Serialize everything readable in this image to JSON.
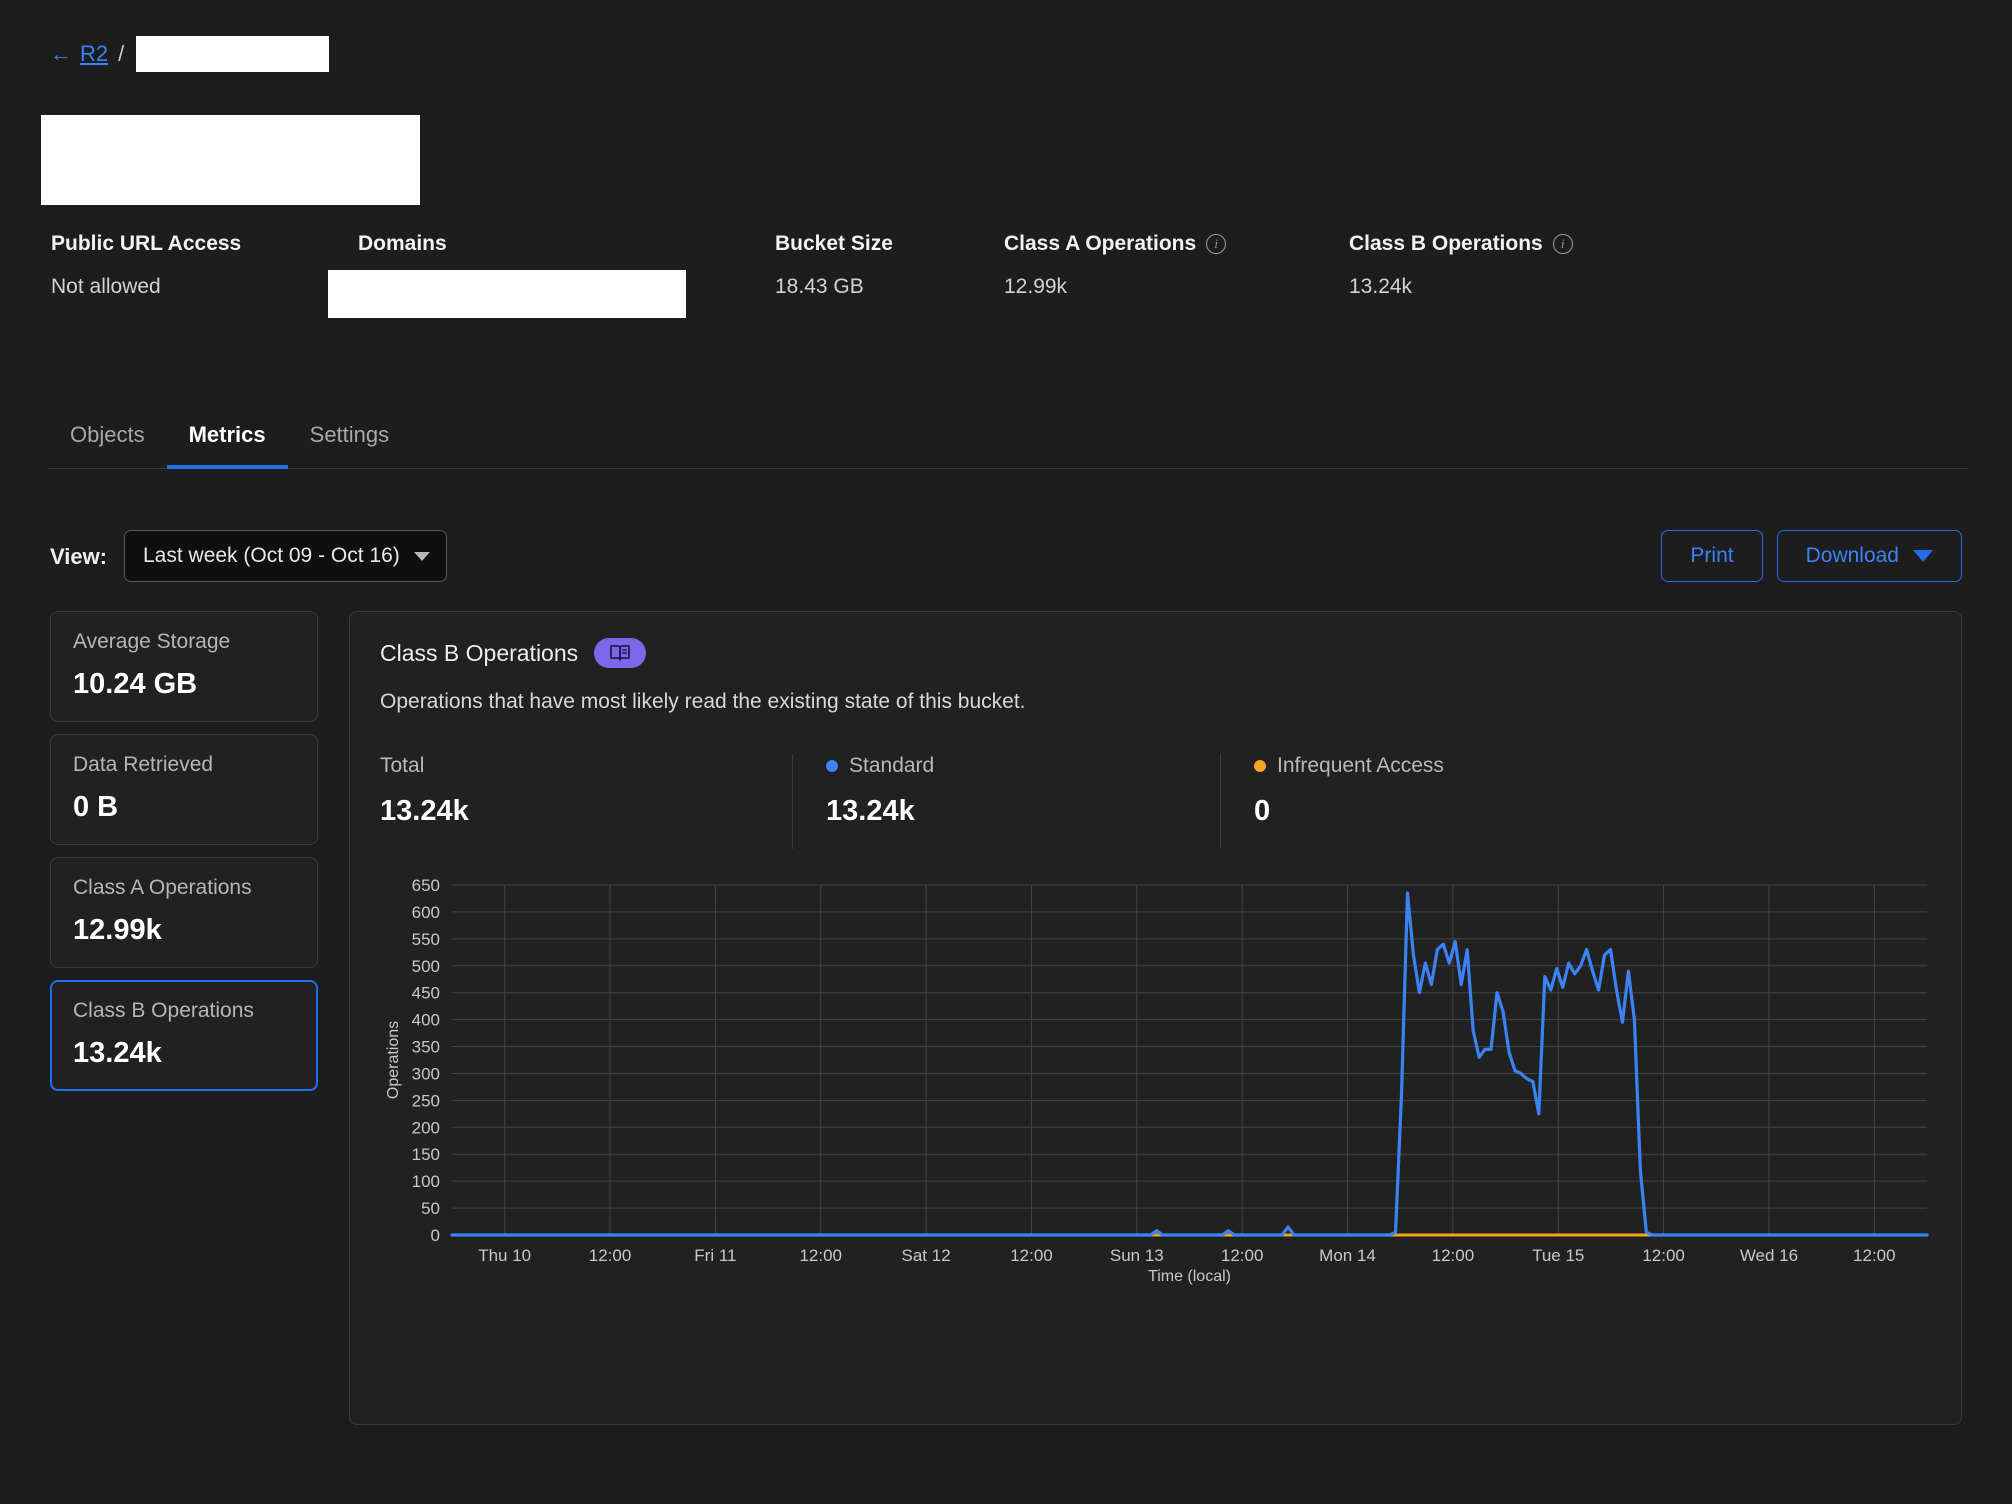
{
  "breadcrumb": {
    "back_icon": "arrow-left-icon",
    "root_label": "R2",
    "separator": "/",
    "bucket_name_redacted": true
  },
  "header_stats": [
    {
      "label": "Public URL Access",
      "value": "Not allowed",
      "info": false
    },
    {
      "label": "Domains",
      "value": "",
      "info": false,
      "redacted": true
    },
    {
      "label": "Bucket Size",
      "value": "18.43 GB",
      "info": false
    },
    {
      "label": "Class A Operations",
      "value": "12.99k",
      "info": true
    },
    {
      "label": "Class B Operations",
      "value": "13.24k",
      "info": true
    }
  ],
  "tabs": [
    {
      "label": "Objects",
      "active": false
    },
    {
      "label": "Metrics",
      "active": true
    },
    {
      "label": "Settings",
      "active": false
    }
  ],
  "toolbar": {
    "view_label": "View:",
    "view_value": "Last week (Oct 09 - Oct 16)",
    "print_label": "Print",
    "download_label": "Download"
  },
  "metric_cards": [
    {
      "label": "Average Storage",
      "value": "10.24 GB",
      "selected": false
    },
    {
      "label": "Data Retrieved",
      "value": "0 B",
      "selected": false
    },
    {
      "label": "Class A Operations",
      "value": "12.99k",
      "selected": false
    },
    {
      "label": "Class B Operations",
      "value": "13.24k",
      "selected": true
    }
  ],
  "panel": {
    "title": "Class B Operations",
    "badge_icon": "book-icon",
    "description": "Operations that have most likely read the existing state of this bucket.",
    "totals": [
      {
        "label": "Total",
        "value": "13.24k",
        "dot_color": null
      },
      {
        "label": "Standard",
        "value": "13.24k",
        "dot_color": "#3b82f6"
      },
      {
        "label": "Infrequent Access",
        "value": "0",
        "dot_color": "#f5a524"
      }
    ]
  },
  "colors": {
    "accent_blue": "#1f6feb",
    "link_blue": "#3b82f6",
    "standard_series": "#3b82f6",
    "infrequent_series": "#f5a524",
    "badge_purple": "#7b68e8",
    "page_bg": "#1d1d1d",
    "panel_bg": "#212121",
    "border": "#3a3a3a"
  },
  "chart_data": {
    "type": "line",
    "title": "",
    "xlabel": "Time (local)",
    "ylabel": "Operations",
    "ylim": [
      0,
      650
    ],
    "yticks": [
      0,
      50,
      100,
      150,
      200,
      250,
      300,
      350,
      400,
      450,
      500,
      550,
      600,
      650
    ],
    "xticks": [
      "Thu 10",
      "12:00",
      "Fri 11",
      "12:00",
      "Sat 12",
      "12:00",
      "Sun 13",
      "12:00",
      "Mon 14",
      "12:00",
      "Tue 15",
      "12:00",
      "Wed 16",
      "12:00"
    ],
    "grid": true,
    "legend": [
      "Standard",
      "Infrequent Access"
    ],
    "legend_position": "top",
    "series": [
      {
        "name": "Standard",
        "color": "#3b82f6",
        "values": [
          0,
          0,
          0,
          0,
          0,
          0,
          0,
          0,
          0,
          0,
          0,
          0,
          0,
          0,
          0,
          0,
          0,
          0,
          0,
          0,
          0,
          0,
          0,
          0,
          0,
          0,
          0,
          0,
          0,
          0,
          0,
          0,
          0,
          0,
          0,
          0,
          0,
          0,
          0,
          0,
          0,
          0,
          0,
          0,
          0,
          0,
          0,
          0,
          0,
          0,
          0,
          0,
          0,
          0,
          0,
          0,
          0,
          0,
          0,
          0,
          0,
          0,
          0,
          0,
          0,
          0,
          0,
          0,
          0,
          0,
          0,
          0,
          0,
          0,
          0,
          0,
          0,
          0,
          0,
          0,
          0,
          0,
          0,
          0,
          0,
          0,
          0,
          0,
          0,
          0,
          0,
          0,
          0,
          0,
          0,
          0,
          0,
          0,
          0,
          0,
          0,
          0,
          0,
          0,
          0,
          0,
          0,
          0,
          0,
          0,
          0,
          0,
          0,
          0,
          0,
          0,
          0,
          0,
          8,
          0,
          0,
          0,
          0,
          0,
          0,
          0,
          0,
          0,
          0,
          0,
          8,
          0,
          0,
          0,
          0,
          0,
          0,
          0,
          0,
          0,
          15,
          0,
          0,
          0,
          0,
          0,
          0,
          0,
          0,
          0,
          0,
          0,
          0,
          0,
          0,
          0,
          0,
          0,
          5,
          260,
          635,
          520,
          450,
          505,
          465,
          530,
          540,
          505,
          545,
          465,
          530,
          380,
          330,
          345,
          345,
          450,
          415,
          340,
          305,
          300,
          290,
          285,
          225,
          480,
          455,
          495,
          460,
          505,
          485,
          500,
          530,
          490,
          455,
          520,
          530,
          455,
          395,
          490,
          400,
          120,
          5,
          0,
          0,
          0,
          0,
          0,
          0,
          0,
          0,
          0,
          0,
          0,
          0,
          0,
          0,
          0,
          0,
          0,
          0,
          0,
          0,
          0,
          0,
          0,
          0,
          0,
          0,
          0,
          0,
          0,
          0,
          0,
          0,
          0,
          0,
          0,
          0,
          0,
          0,
          0,
          0,
          0,
          0,
          0,
          0,
          0,
          0,
          0
        ]
      },
      {
        "name": "Infrequent Access",
        "color": "#f5a524",
        "values": [
          0
        ]
      }
    ]
  }
}
